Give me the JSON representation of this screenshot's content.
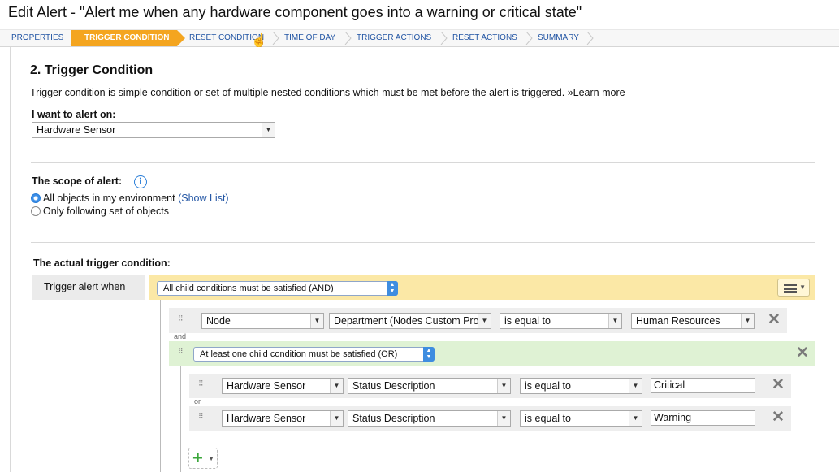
{
  "window": {
    "title": "Edit Alert - \"Alert me when any hardware component goes into a warning or critical state\""
  },
  "wizard": {
    "steps": [
      {
        "label": "PROPERTIES",
        "active": false
      },
      {
        "label": "TRIGGER CONDITION",
        "active": true
      },
      {
        "label": "RESET CONDITION",
        "active": false
      },
      {
        "label": "TIME OF DAY",
        "active": false
      },
      {
        "label": "TRIGGER ACTIONS",
        "active": false
      },
      {
        "label": "RESET ACTIONS",
        "active": false
      },
      {
        "label": "SUMMARY",
        "active": false
      }
    ],
    "active_color": "#f4a51f"
  },
  "section": {
    "heading": "2. Trigger Condition",
    "description": "Trigger condition is simple condition or set of multiple nested conditions which must be met before the alert is triggered.",
    "learn_more_prefix": "»",
    "learn_more": "Learn more"
  },
  "alert_on": {
    "label": "I want to alert on:",
    "value": "Hardware Sensor"
  },
  "scope": {
    "label": "The scope of alert:",
    "option_all": "All objects in my environment",
    "show_list": "(Show List)",
    "option_following": "Only following set of objects",
    "selected": "all"
  },
  "trigger": {
    "label": "The actual trigger condition:",
    "when_label": "Trigger alert when",
    "root_logic": "All child conditions must be satisfied (AND)",
    "row1": {
      "object": "Node",
      "field": "Department (Nodes Custom Prop",
      "operator": "is equal to",
      "value": "Human Resources"
    },
    "conj_and": "and",
    "group_logic": "At least one child condition must be satisfied (OR)",
    "sub_row1": {
      "object": "Hardware Sensor",
      "field": "Status Description",
      "operator": "is equal to",
      "value": "Critical"
    },
    "conj_or": "or",
    "sub_row2": {
      "object": "Hardware Sensor",
      "field": "Status Description",
      "operator": "is equal to",
      "value": "Warning"
    }
  },
  "colors": {
    "and_band": "#fbe8a6",
    "or_band": "#dff2d4",
    "link": "#2255a4"
  }
}
